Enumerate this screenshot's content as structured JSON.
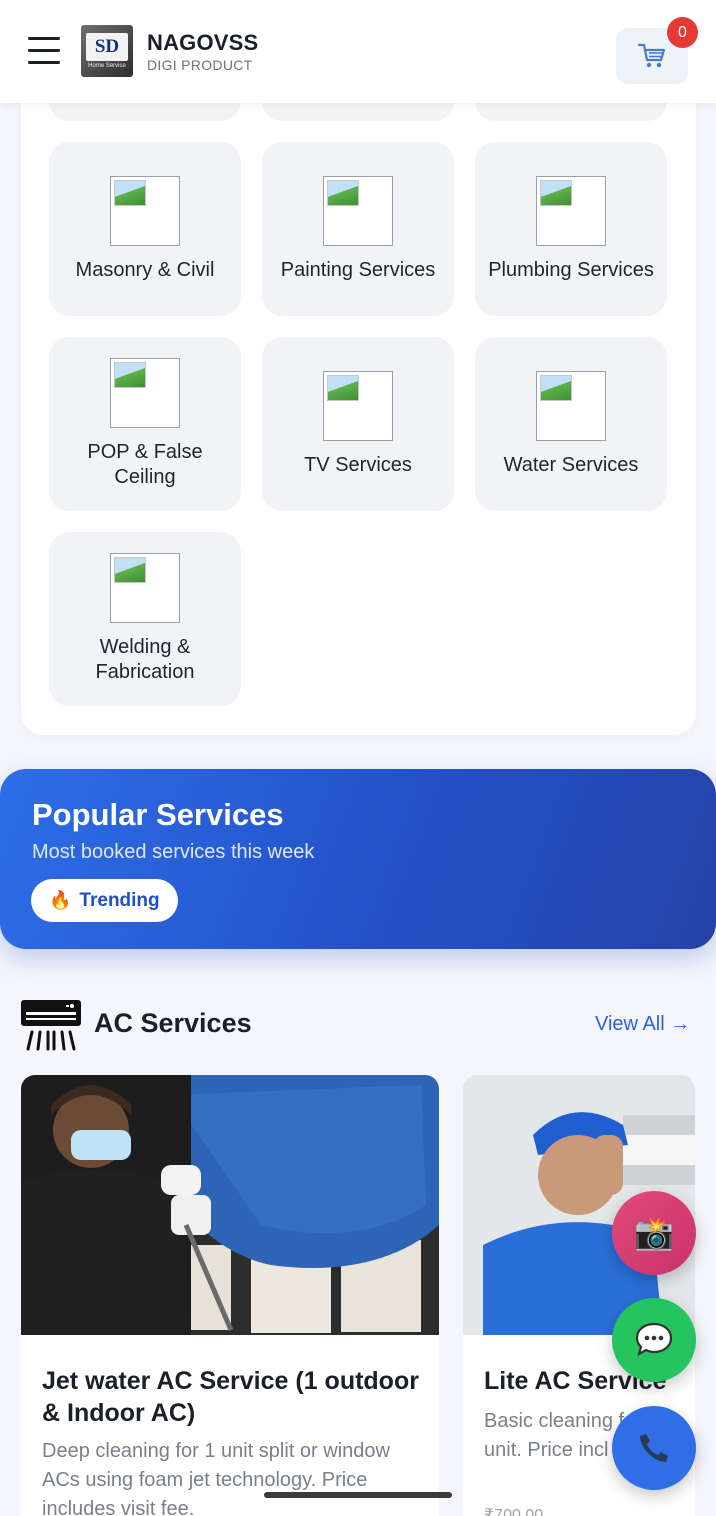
{
  "header": {
    "brand_name": "NAGOVSS",
    "brand_sub": "DIGI PRODUCT",
    "logo_mark": "SD",
    "logo_sub": "Home Service",
    "cart_count": "0",
    "icons": [
      "menu-icon",
      "cart-icon"
    ]
  },
  "categories": [
    {
      "label": "Masonry & Civil"
    },
    {
      "label": "Painting Services"
    },
    {
      "label": "Plumbing Services"
    },
    {
      "label": "POP & False Ceiling"
    },
    {
      "label": "TV Services"
    },
    {
      "label": "Water Services"
    },
    {
      "label": "Welding & Fabrication"
    }
  ],
  "popular": {
    "title": "Popular Services",
    "subtitle": "Most booked services this week",
    "trend_label": "Trending",
    "trend_icon": "🔥"
  },
  "ac_section": {
    "title": "AC Services",
    "view_all": "View All →",
    "cards": [
      {
        "name": "Jet water AC Service (1 outdoor & Indoor AC)",
        "description": "Deep cleaning for 1 unit split or window ACs using foam jet technology. Price includes visit fee.",
        "price": ""
      },
      {
        "name": "Lite AC Service",
        "description": "Basic cleaning for 1 unit. Price incl",
        "price": "₹700.00"
      }
    ]
  },
  "fabs": {
    "instagram_icon": "📸",
    "chat_icon": "💬",
    "phone_icon": "📞"
  },
  "colors": {
    "primary": "#2a64d6",
    "banner_start": "#2d6ee8",
    "banner_end": "#2443a8",
    "badge": "#e53935",
    "whatsapp": "#25c45f",
    "instagram": "#d83a6f",
    "call": "#2f6ee6"
  }
}
